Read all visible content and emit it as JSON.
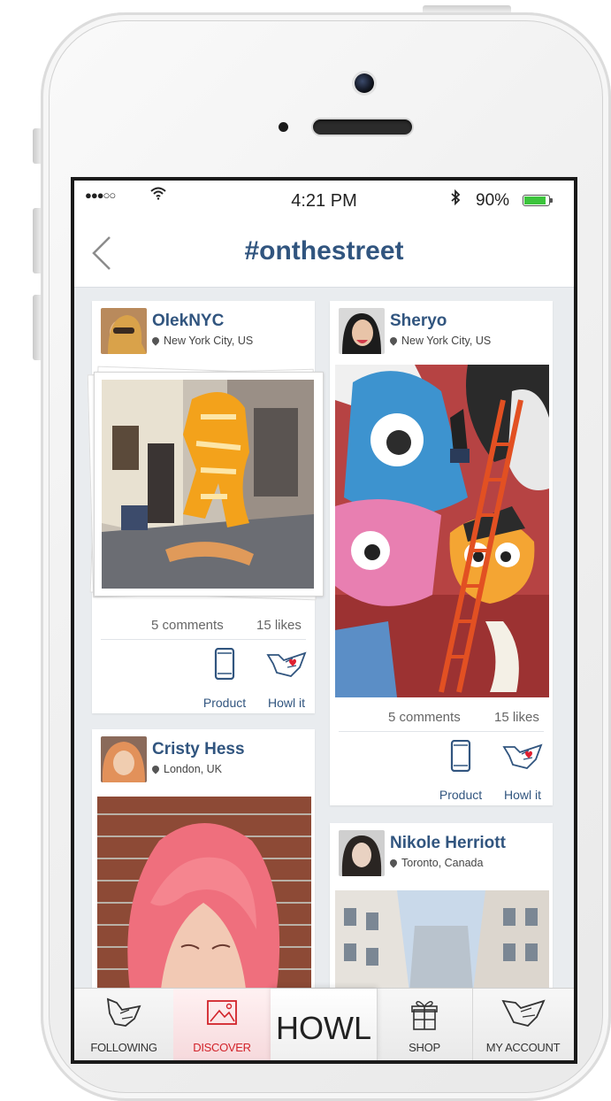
{
  "status_bar": {
    "signal": "●●●○○",
    "wifi": "ᯤ",
    "time": "4:21 PM",
    "bluetooth": "✻",
    "battery_text": "90%",
    "battery_level": 0.9
  },
  "nav": {
    "back_icon": "chevron-left-icon",
    "title": "#onthestreet"
  },
  "posts": [
    {
      "user": "OlekNYC",
      "location": "New York City, US",
      "comments": "5 comments",
      "likes": "15 likes",
      "product_label": "Product",
      "howl_label": "Howl it"
    },
    {
      "user": "Sheryo",
      "location": "New York City, US",
      "comments": "5 comments",
      "likes": "15 likes",
      "product_label": "Product",
      "howl_label": "Howl it"
    },
    {
      "user": "Cristy Hess",
      "location": "London, UK"
    },
    {
      "user": "Nikole Herriott",
      "location": "Toronto, Canada"
    }
  ],
  "tabs": {
    "following": "FOLLOWING",
    "discover": "DISCOVER",
    "howl": "HOWL",
    "shop": "SHOP",
    "account": "MY ACCOUNT"
  },
  "colors": {
    "accent": "#31557f",
    "active_tab": "#d2232a",
    "heart": "#e02030"
  }
}
